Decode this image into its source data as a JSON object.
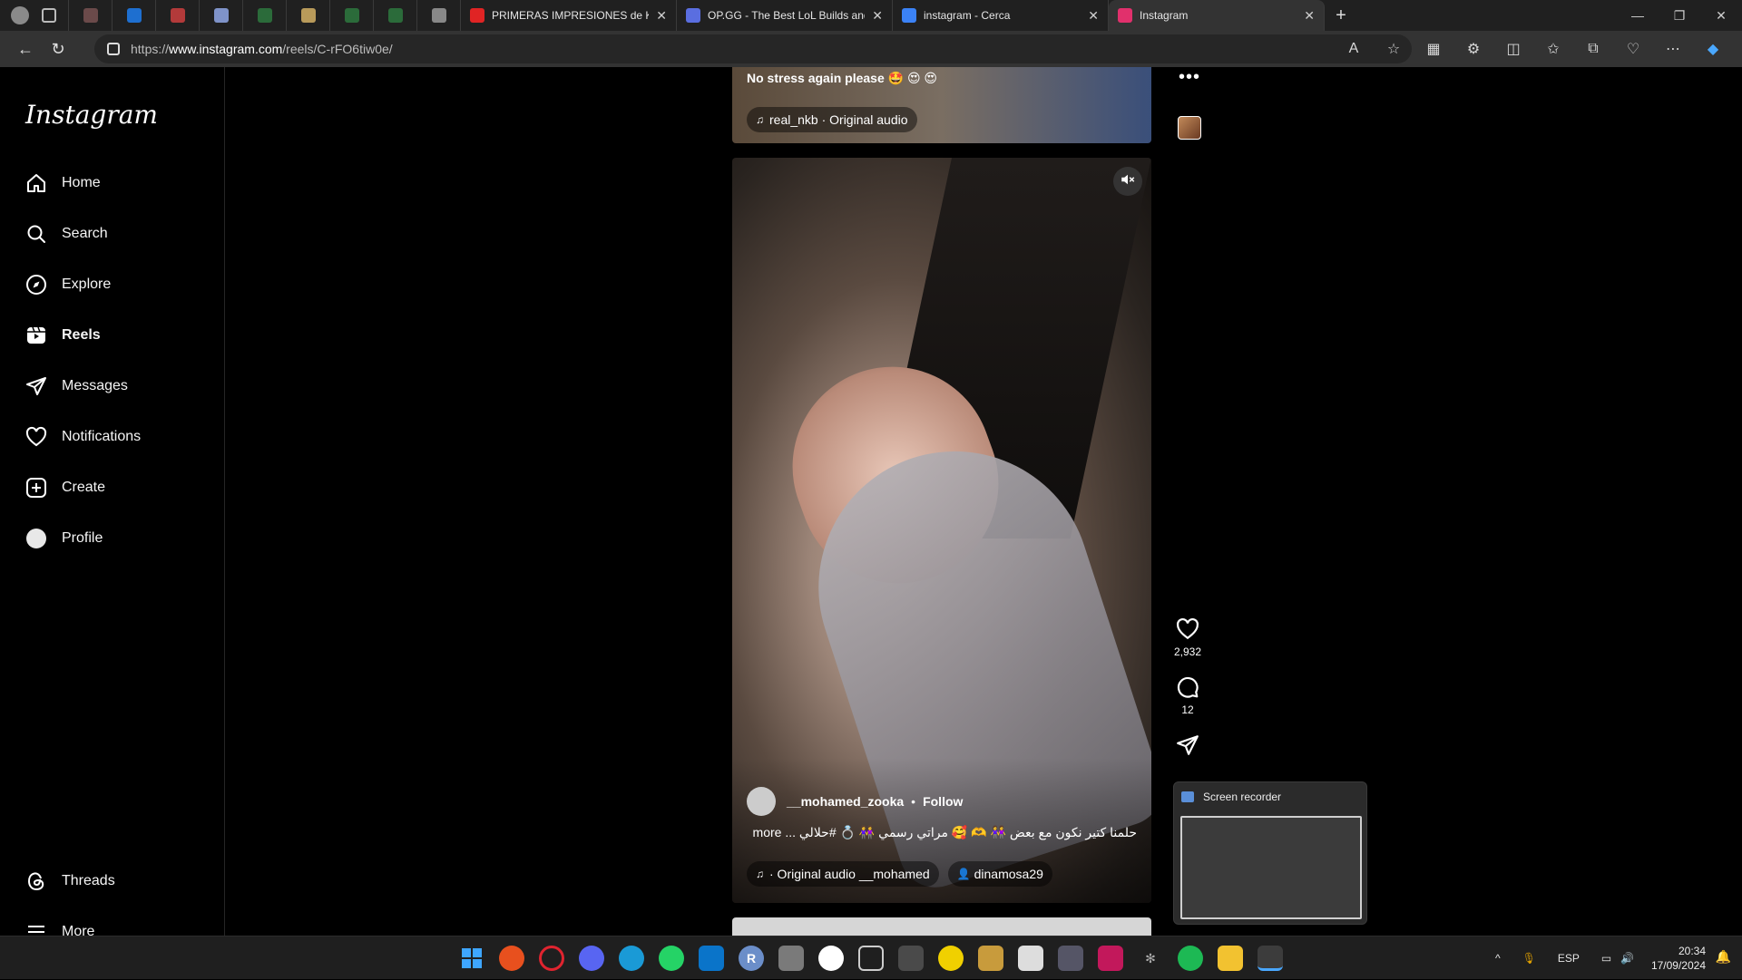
{
  "browser": {
    "tabs": [
      {
        "title": "PRIMERAS IMPRESIONES de K",
        "favicon_color": "#e02424"
      },
      {
        "title": "OP.GG - The Best LoL Builds and",
        "favicon_color": "#5a6ee0"
      },
      {
        "title": "instagram - Cerca",
        "favicon_color": "#3b82f6"
      },
      {
        "title": "Instagram",
        "favicon_color": "#e1306c"
      }
    ],
    "mini_tab_colors": [
      "#6b4a4a",
      "#1e6fd0",
      "#b33a3a",
      "#7f93c9",
      "#2b6b3a",
      "#b89a5a",
      "#2b6b3a",
      "#2b6b3a",
      "#888888"
    ],
    "url_host": "www.instagram.com",
    "url_prefix": "https://",
    "url_path": "/reels/C-rFO6tiw0e/"
  },
  "sidebar": {
    "logo": "Instagram",
    "items": [
      {
        "label": "Home",
        "icon": "home-icon"
      },
      {
        "label": "Search",
        "icon": "search-icon"
      },
      {
        "label": "Explore",
        "icon": "explore-icon"
      },
      {
        "label": "Reels",
        "icon": "reels-icon"
      },
      {
        "label": "Messages",
        "icon": "messages-icon"
      },
      {
        "label": "Notifications",
        "icon": "heart-icon"
      },
      {
        "label": "Create",
        "icon": "create-icon"
      },
      {
        "label": "Profile",
        "icon": "profile-icon"
      }
    ],
    "threads": "Threads",
    "more": "More"
  },
  "reels": {
    "previous": {
      "caption": "No stress again please 🤩 😍 😍",
      "audio": "real_nkb · Original audio"
    },
    "current": {
      "username": "__mohamed_zooka",
      "follow_label": "Follow",
      "caption": "حلمنا كتير نكون مع بعض 👭 🫶 🥰 مراتي رسمي 👭 💍 #حلالي ... more",
      "audio": "· Original audio  __mohamed",
      "tagged_user": "dinamosa29",
      "likes": "2,932",
      "comments": "12"
    }
  },
  "recorder": {
    "title": "Screen recorder"
  },
  "taskbar": {
    "lang": "ESP",
    "time": "20:34",
    "date": "17/09/2024"
  }
}
